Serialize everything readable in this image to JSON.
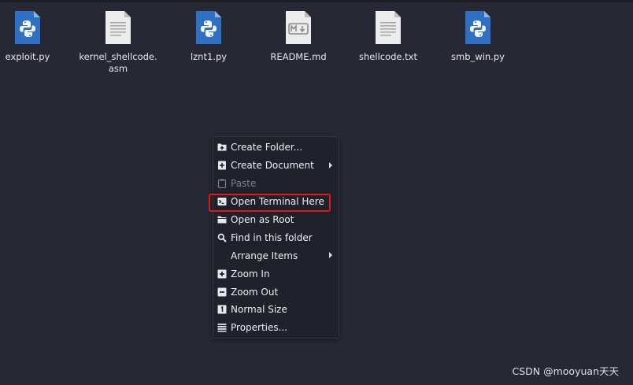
{
  "files": [
    {
      "name": "exploit.py",
      "type": "python"
    },
    {
      "name": "kernel_shellcode.asm",
      "type": "text"
    },
    {
      "name": "lznt1.py",
      "type": "python"
    },
    {
      "name": "README.md",
      "type": "markdown"
    },
    {
      "name": "shellcode.txt",
      "type": "text"
    },
    {
      "name": "smb_win.py",
      "type": "python"
    }
  ],
  "context_menu": {
    "items": [
      {
        "label": "Create Folder...",
        "icon": "folder-plus-icon",
        "submenu": false,
        "disabled": false
      },
      {
        "label": "Create Document",
        "icon": "document-plus-icon",
        "submenu": true,
        "disabled": false
      },
      {
        "label": "Paste",
        "icon": "clipboard-icon",
        "submenu": false,
        "disabled": true
      },
      {
        "label": "Open Terminal Here",
        "icon": "terminal-icon",
        "submenu": false,
        "disabled": false,
        "highlighted": true
      },
      {
        "label": "Open as Root",
        "icon": "folder-icon",
        "submenu": false,
        "disabled": false
      },
      {
        "label": "Find in this folder",
        "icon": "search-icon",
        "submenu": false,
        "disabled": false
      },
      {
        "label": "Arrange Items",
        "icon": "",
        "submenu": true,
        "disabled": false
      },
      {
        "label": "Zoom In",
        "icon": "zoom-in-icon",
        "submenu": false,
        "disabled": false
      },
      {
        "label": "Zoom Out",
        "icon": "zoom-out-icon",
        "submenu": false,
        "disabled": false
      },
      {
        "label": "Normal Size",
        "icon": "normal-size-icon",
        "submenu": false,
        "disabled": false
      },
      {
        "label": "Properties...",
        "icon": "properties-icon",
        "submenu": false,
        "disabled": false
      }
    ]
  },
  "watermark": "CSDN @mooyuan天天",
  "colors": {
    "background": "#262834",
    "menu_background": "#1f212b",
    "highlight_border": "#e0161b",
    "python_icon": "#2f6fc4"
  }
}
